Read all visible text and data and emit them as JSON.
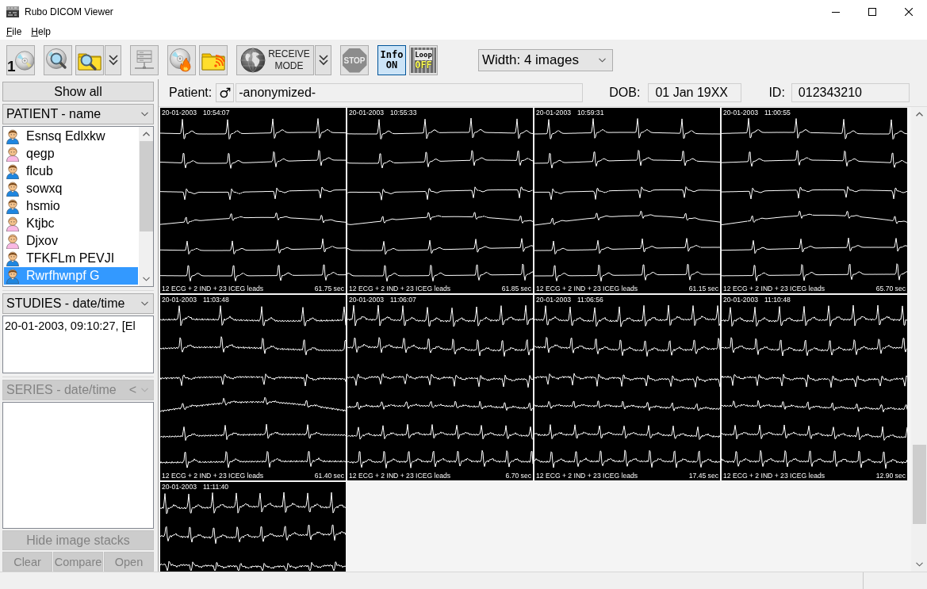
{
  "window": {
    "title": "Rubo DICOM Viewer"
  },
  "menu": [
    {
      "label": "File"
    },
    {
      "label": "Help"
    }
  ],
  "toolbar": {
    "groups": [
      [
        {
          "kind": "icon",
          "badge": "1",
          "pressed": false
        }
      ],
      [
        {
          "kind": "icon",
          "pressed": false
        },
        {
          "kind": "icon",
          "pressed": false
        },
        {
          "kind": "arrow",
          "pressed": false
        }
      ],
      [
        {
          "kind": "icon",
          "pressed": false
        }
      ],
      [
        {
          "kind": "icon",
          "pressed": false
        },
        {
          "kind": "icon",
          "pressed": false
        }
      ],
      [
        {
          "kind": "caption",
          "lines": [
            "RECEIVE",
            "MODE"
          ],
          "pressed": false
        },
        {
          "kind": "arrow",
          "pressed": false
        }
      ],
      [
        {
          "kind": "sign",
          "text": "STOP",
          "pressed": false
        }
      ],
      [
        {
          "kind": "toggle",
          "lines": [
            "Info",
            "ON"
          ],
          "pressed": true
        },
        {
          "kind": "toggle",
          "lines": [
            "Loop",
            "OFF"
          ],
          "pressed": false
        }
      ]
    ],
    "width_select": {
      "value": "Width: 4 images"
    }
  },
  "sidebar": {
    "show_all": {
      "label": "Show all",
      "disabled": false
    },
    "patient_header": {
      "label": "PATIENT - name",
      "disabled": false
    },
    "patients": [
      {
        "name": "Esnsq Edlxkw",
        "kind": "male",
        "selected": false
      },
      {
        "name": "qegp",
        "kind": "female",
        "selected": false
      },
      {
        "name": "flcub",
        "kind": "male",
        "selected": false
      },
      {
        "name": "sowxq",
        "kind": "male",
        "selected": false
      },
      {
        "name": "hsmio",
        "kind": "male",
        "selected": false
      },
      {
        "name": "Ktjbc",
        "kind": "female",
        "selected": false
      },
      {
        "name": "Djxov",
        "kind": "female",
        "selected": false
      },
      {
        "name": "TFKFLm PEVJI",
        "kind": "male",
        "selected": false
      },
      {
        "name": "Rwrfhwnpf G",
        "kind": "male",
        "selected": true
      }
    ],
    "studies_header": {
      "label": "STUDIES - date/time",
      "disabled": false
    },
    "studies": [
      {
        "label": "20-01-2003, 09:10:27, [El",
        "selected": false
      }
    ],
    "series_header": {
      "label": "SERIES - date/time",
      "toggle": "<",
      "disabled": true
    },
    "hide_stacks": {
      "label": "Hide image stacks",
      "disabled": true
    },
    "actions": [
      {
        "label": "Clear",
        "disabled": true
      },
      {
        "label": "Compare",
        "disabled": true
      },
      {
        "label": "Open",
        "disabled": true
      }
    ]
  },
  "patient_bar": {
    "label": "Patient:",
    "sex_symbol": "♂",
    "name": "-anonymized-",
    "dob_label": "DOB:",
    "dob": "01 Jan 19XX",
    "id_label": "ID:",
    "id": "012343210"
  },
  "images": [
    {
      "date": "20-01-2003",
      "time": "10:54:07",
      "leads": "12 ECG + 2 IND + 23 ICEG leads",
      "duration": "61.75 sec"
    },
    {
      "date": "20-01-2003",
      "time": "10:55:33",
      "leads": "12 ECG + 2 IND + 23 ICEG leads",
      "duration": "61.85 sec"
    },
    {
      "date": "20-01-2003",
      "time": "10:59:31",
      "leads": "12 ECG + 2 IND + 23 ICEG leads",
      "duration": "61.15 sec"
    },
    {
      "date": "20-01-2003",
      "time": "11:00:55",
      "leads": "12 ECG + 2 IND + 23 ICEG leads",
      "duration": "65.70 sec"
    },
    {
      "date": "20-01-2003",
      "time": "11:03:48",
      "leads": "12 ECG + 2 IND + 23 ICEG leads",
      "duration": "61.40 sec"
    },
    {
      "date": "20-01-2003",
      "time": "11:06:07",
      "leads": "12 ECG + 2 IND + 23 ICEG leads",
      "duration": "6.70 sec"
    },
    {
      "date": "20-01-2003",
      "time": "11:06:56",
      "leads": "12 ECG + 2 IND + 23 ICEG leads",
      "duration": "17.45 sec"
    },
    {
      "date": "20-01-2003",
      "time": "11:10:48",
      "leads": "12 ECG + 2 IND + 23 ICEG leads",
      "duration": "12.90 sec"
    },
    {
      "date": "20-01-2003",
      "time": "11:11:40"
    }
  ]
}
